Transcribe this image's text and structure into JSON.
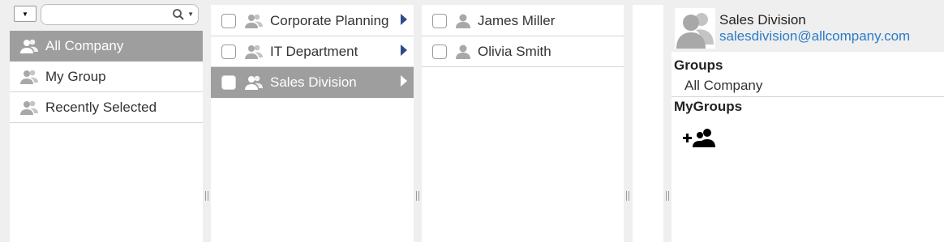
{
  "search": {
    "value": "",
    "placeholder": ""
  },
  "left_nav": {
    "items": [
      {
        "label": "All Company",
        "selected": true
      },
      {
        "label": "My Group",
        "selected": false
      },
      {
        "label": "Recently Selected",
        "selected": false
      }
    ]
  },
  "departments": {
    "items": [
      {
        "label": "Corporate Planning",
        "selected": false,
        "has_children": true
      },
      {
        "label": "IT Department",
        "selected": false,
        "has_children": true
      },
      {
        "label": "Sales Division",
        "selected": true,
        "has_children": true
      }
    ]
  },
  "members": {
    "items": [
      {
        "label": "James Miller"
      },
      {
        "label": "Olivia Smith"
      }
    ]
  },
  "detail": {
    "name": "Sales Division",
    "email": "salesdivision@allcompany.com",
    "groups_title": "Groups",
    "groups": [
      "All Company"
    ],
    "mygroups_title": "MyGroups"
  },
  "colors": {
    "selected_bg": "#9e9e9e",
    "link": "#2b7cc7",
    "arrow": "#2f4a8a",
    "icon_gray": "#a8a8a8"
  },
  "icons": {
    "group": "group-icon",
    "person": "person-icon",
    "search": "search-icon",
    "add_group": "add-group-icon"
  }
}
